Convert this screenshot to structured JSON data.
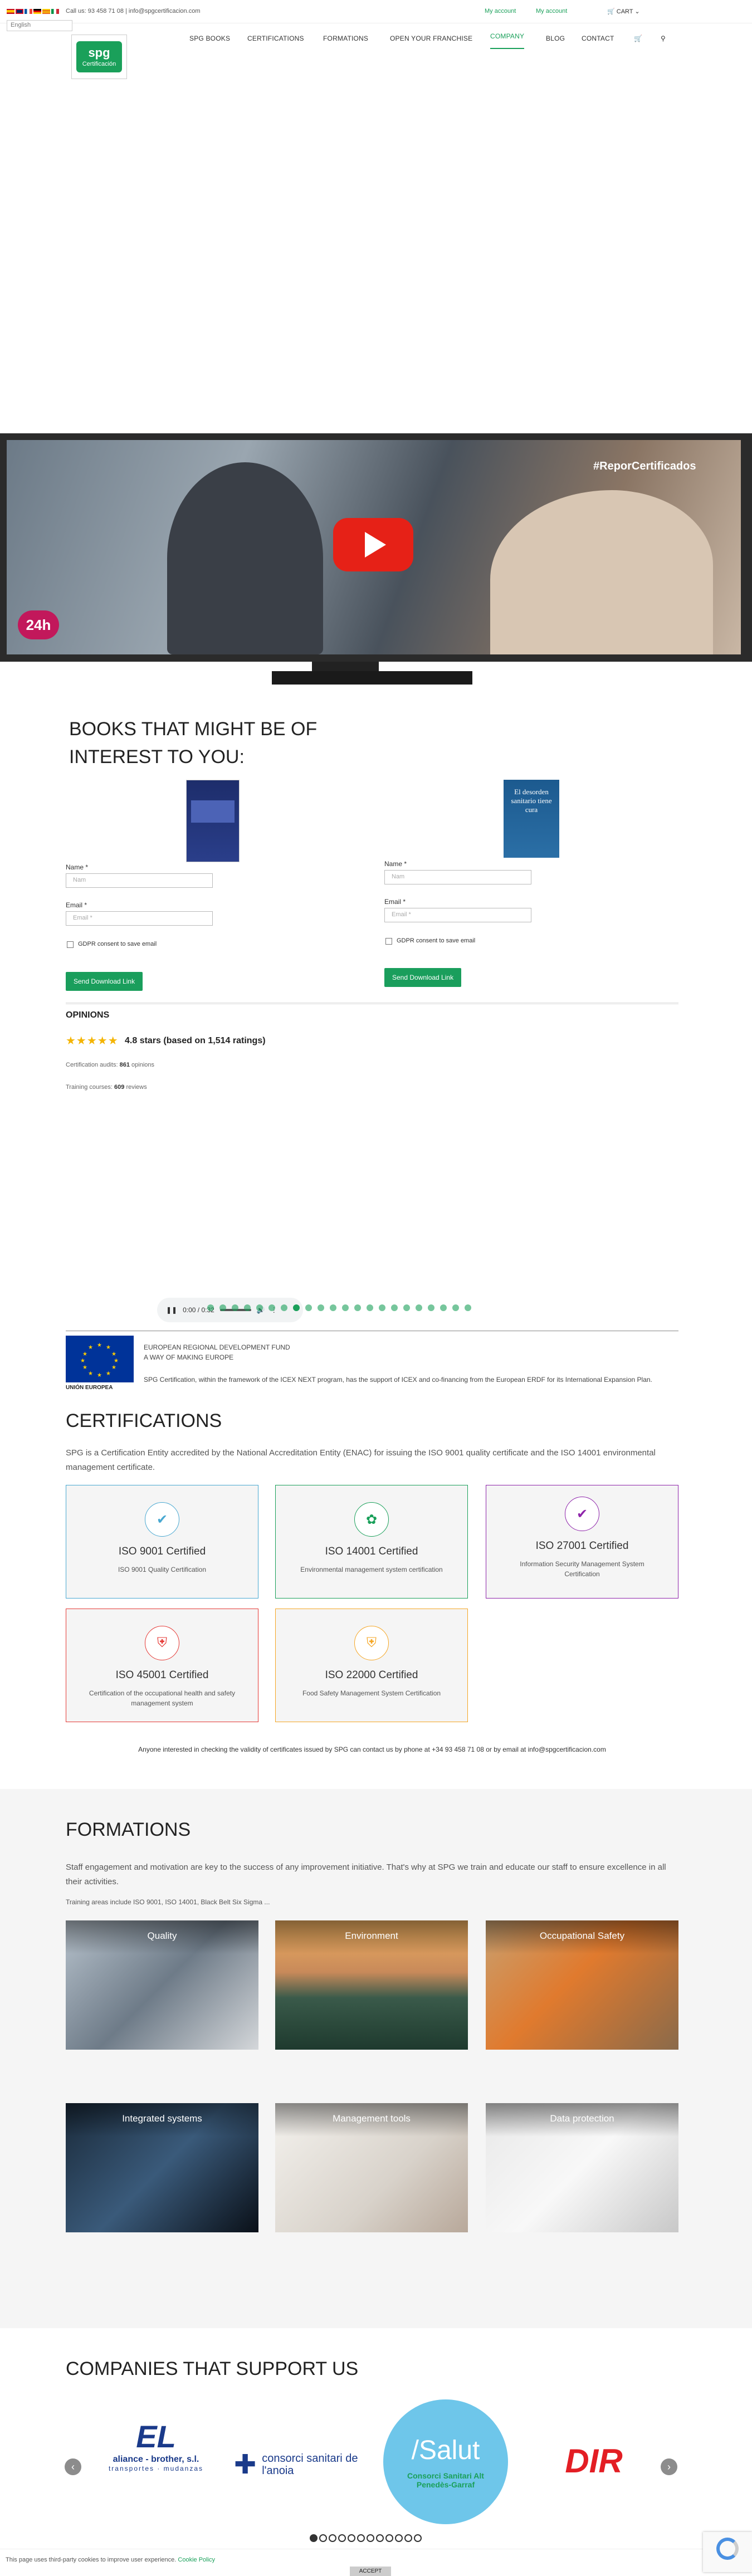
{
  "topbar": {
    "contact": "Call us: 93 458 71 08  |  info@spgcertificacion.com",
    "language": "English",
    "my_account_1": "My account",
    "my_account_2": "My account",
    "cart": "CART"
  },
  "nav": {
    "items": [
      "SPG BOOKS",
      "CERTIFICATIONS",
      "FORMATIONS",
      "OPEN YOUR FRANCHISE",
      "COMPANY",
      "BLOG",
      "CONTACT"
    ],
    "active": "COMPANY"
  },
  "logo": {
    "text": "spg",
    "sub": "Certificación"
  },
  "video": {
    "hashtag": "#ReporCertificados",
    "badge": "24h"
  },
  "books": {
    "title": "BOOKS THAT MIGHT BE OF INTEREST TO YOU:",
    "forms": [
      {
        "name_label": "Name *",
        "name_placeholder": "Nam",
        "email_label": "Email *",
        "email_placeholder": "Email *",
        "gdpr": "GDPR consent to save email",
        "button": "Send Download Link"
      },
      {
        "name_label": "Name *",
        "name_placeholder": "Nam",
        "email_label": "Email *",
        "email_placeholder": "Email *",
        "gdpr": "GDPR consent to save email",
        "button": "Send Download Link"
      }
    ],
    "cover2_title": "El desorden sanitario tiene cura"
  },
  "opinions": {
    "title": "OPINIONS",
    "stars": "★★★★★",
    "rating": "4.8 stars (based on 1,514 ratings)",
    "audits_label": "Certification audits:",
    "audits_value": "861",
    "audits_suffix": "opinions",
    "courses_label": "Training courses:",
    "courses_value": "609",
    "courses_suffix": "reviews"
  },
  "audio": {
    "time": "0:00 / 0:32"
  },
  "eu": {
    "label": "UNIÓN EUROPEA",
    "fund": "EUROPEAN REGIONAL DEVELOPMENT FUND",
    "motto": "A WAY OF MAKING EUROPE",
    "text": "SPG Certification, within the framework of the  ICEX NEXT  program, has the support of  ICEX  and co-financing from the European  ERDF  for its International Expansion Plan."
  },
  "certifications": {
    "title": "CERTIFICATIONS",
    "intro": "SPG is a Certification Entity accredited by the National Accreditation Entity (ENAC) for issuing the ISO 9001  quality certificate and the ISO 14001 environmental management certificate.",
    "cards": [
      {
        "title": "ISO 9001 Certified",
        "sub": "ISO 9001 Quality Certification",
        "color": "#49a8d1",
        "icon": "check-icon"
      },
      {
        "title": "ISO 14001 Certified",
        "sub": "Environmental management system certification",
        "color": "#1aa05a",
        "icon": "leaf-icon"
      },
      {
        "title": "ISO 27001 Certified",
        "sub": "Information Security Management System Certification",
        "color": "#8e24aa",
        "icon": "check-icon"
      },
      {
        "title": "ISO 45001 Certified",
        "sub": "Certification of the occupational health and safety management system",
        "color": "#e53935",
        "icon": "shield-icon"
      },
      {
        "title": "ISO 22000 Certified",
        "sub": "Food Safety Management System Certification",
        "color": "#f5a623",
        "icon": "shield-icon"
      }
    ],
    "validity": "Anyone interested in checking the validity of certificates issued by SPG can contact us by phone at +34 93 458 71 08 or by email at info@spgcertificacion.com"
  },
  "formations": {
    "title": "FORMATIONS",
    "intro": "Staff engagement and motivation are key to the success of any improvement initiative. That's why at SPG we train and educate our staff to ensure excellence in all their activities.",
    "areas": "Training areas include ISO 9001, ISO 14001, Black Belt Six Sigma ...",
    "tiles": [
      "Quality",
      "Environment",
      "Occupational Safety",
      "Integrated systems",
      "Management tools",
      "Data protection"
    ]
  },
  "companies": {
    "title": "COMPANIES THAT SUPPORT US",
    "logos": [
      {
        "name": "aliance - brother, s.l.",
        "sub": "transportes · mudanzas"
      },
      {
        "name": "consorci sanitari de l'anoia"
      },
      {
        "name": "/Salut",
        "sub": "Consorci Sanitari Alt Penedès-Garraf"
      },
      {
        "name": "DIR"
      }
    ]
  },
  "cookie": {
    "text": "This page uses third-party cookies to improve user experience.",
    "link": "Cookie Policy",
    "accept": "ACCEPT"
  }
}
